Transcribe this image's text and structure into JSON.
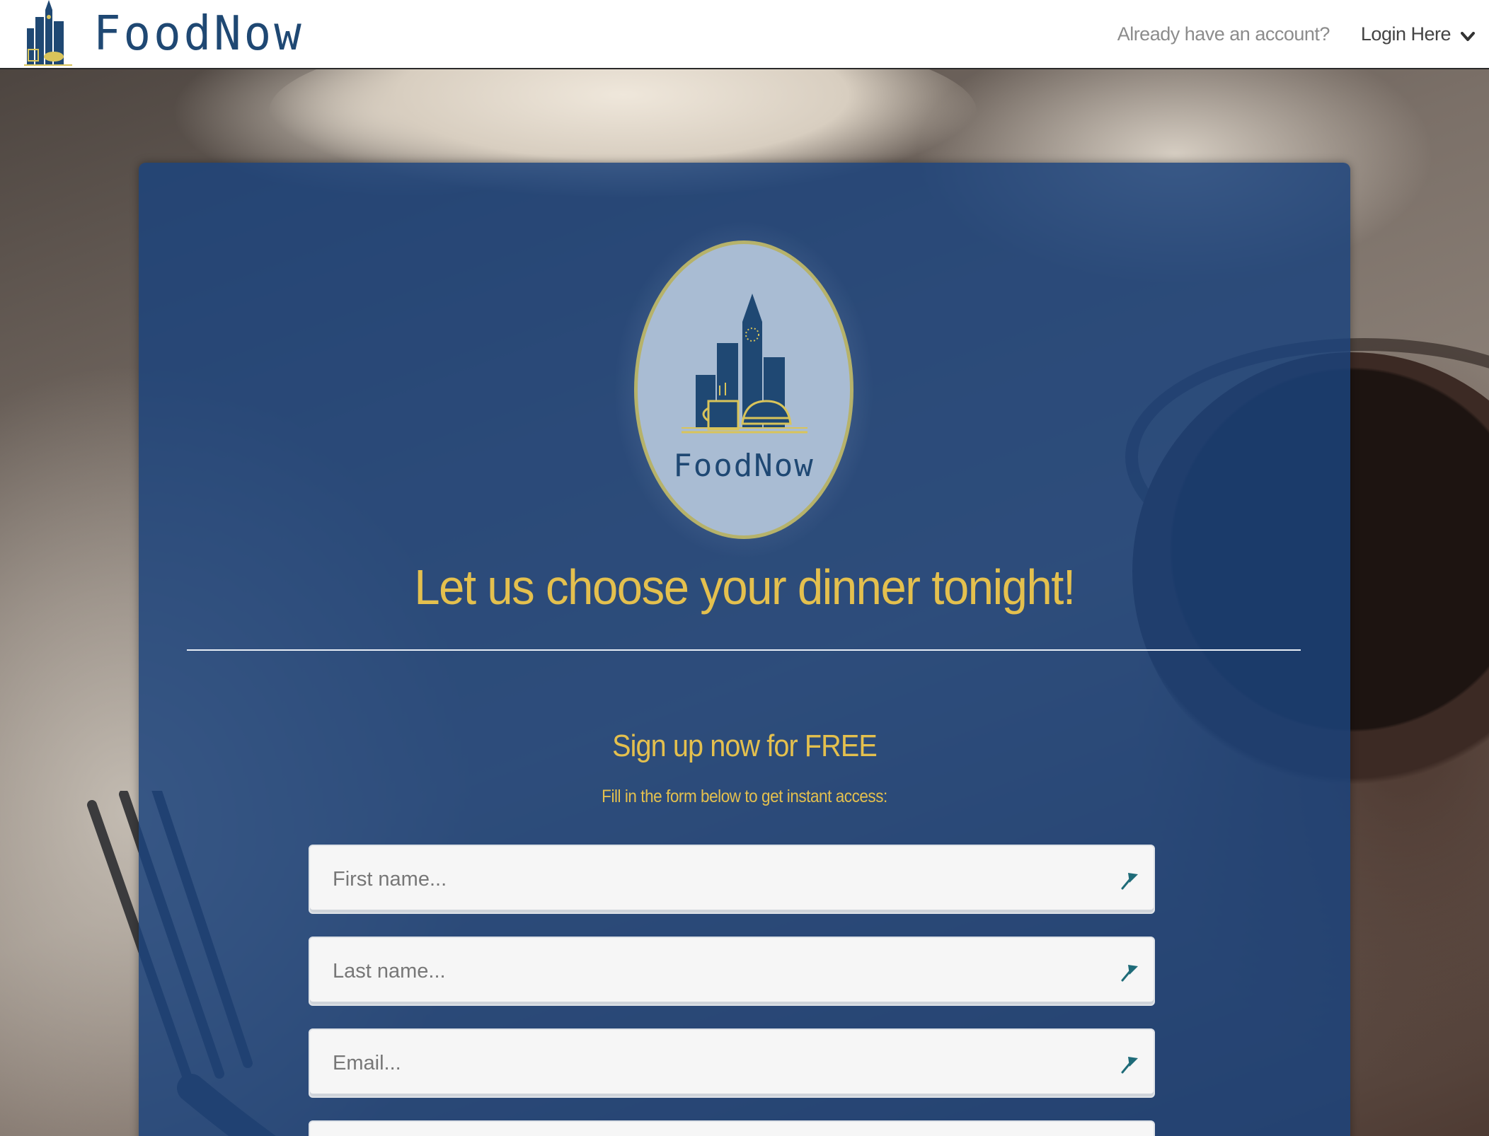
{
  "navbar": {
    "brand_name": "FoodNow",
    "question": "Already have an account?",
    "login_label": "Login Here"
  },
  "hero": {
    "logo_text": "FoodNow",
    "headline": "Let us choose your dinner tonight!"
  },
  "signup": {
    "title": "Sign up now for FREE",
    "subtitle": "Fill in the form below to get instant access:",
    "fields": [
      {
        "placeholder": "First name...",
        "icon": "pin-icon"
      },
      {
        "placeholder": "Last name...",
        "icon": "pin-icon"
      },
      {
        "placeholder": "Email...",
        "icon": "pin-icon"
      },
      {
        "placeholder": "",
        "icon": ""
      }
    ]
  },
  "colors": {
    "brand_blue": "#1f4873",
    "card_blue": "#1b437c",
    "accent_gold": "#e4c04e",
    "nav_text_muted": "#8c8c8c",
    "input_bg": "#f6f6f6"
  }
}
